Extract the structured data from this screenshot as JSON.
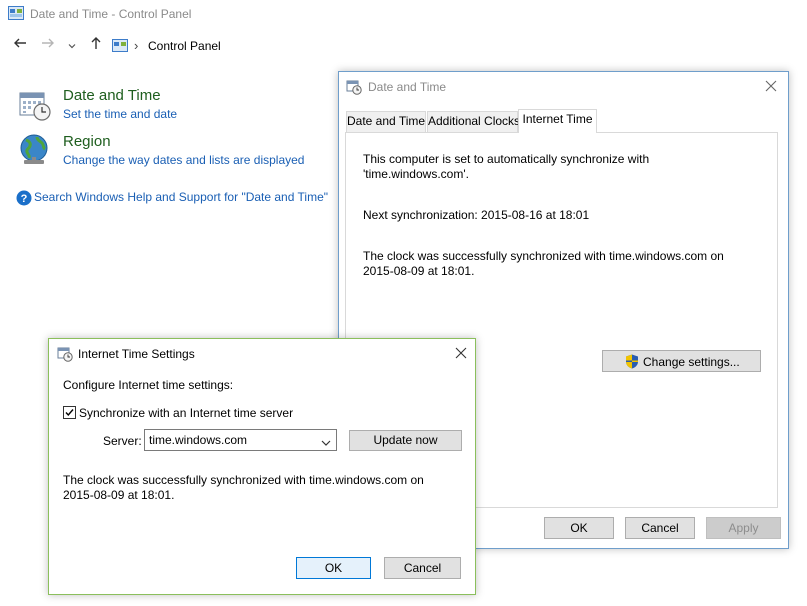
{
  "window": {
    "title": "Date and Time - Control Panel"
  },
  "address": {
    "path": "Control Panel",
    "separator": "›"
  },
  "categories": [
    {
      "title": "Date and Time",
      "subtitle": "Set the time and date"
    },
    {
      "title": "Region",
      "subtitle": "Change the way dates and lists are displayed"
    }
  ],
  "help_link": "Search Windows Help and Support for \"Date and Time\"",
  "datetime_dialog": {
    "title": "Date and Time",
    "tabs": [
      "Date and Time",
      "Additional Clocks",
      "Internet Time"
    ],
    "active_tab": "Internet Time",
    "line1": "This computer is set to automatically synchronize with",
    "line2": "'time.windows.com'.",
    "next_sync": "Next synchronization: 2015-08-16 at 18:01",
    "status1": "The clock was successfully synchronized with time.windows.com on",
    "status2": "2015-08-09 at 18:01.",
    "change_settings": "Change settings...",
    "ok": "OK",
    "cancel": "Cancel",
    "apply": "Apply"
  },
  "inet_dialog": {
    "title": "Internet Time Settings",
    "heading": "Configure Internet time settings:",
    "sync_label": "Synchronize with an Internet time server",
    "sync_checked": true,
    "server_label": "Server:",
    "server_value": "time.windows.com",
    "update_now": "Update now",
    "status1": "The clock was successfully synchronized with time.windows.com on",
    "status2": "2015-08-09 at 18:01.",
    "ok": "OK",
    "cancel": "Cancel"
  },
  "colors": {
    "link": "#1a5fb4",
    "category_title": "#1e5e1e",
    "accent": "#0078d7"
  }
}
